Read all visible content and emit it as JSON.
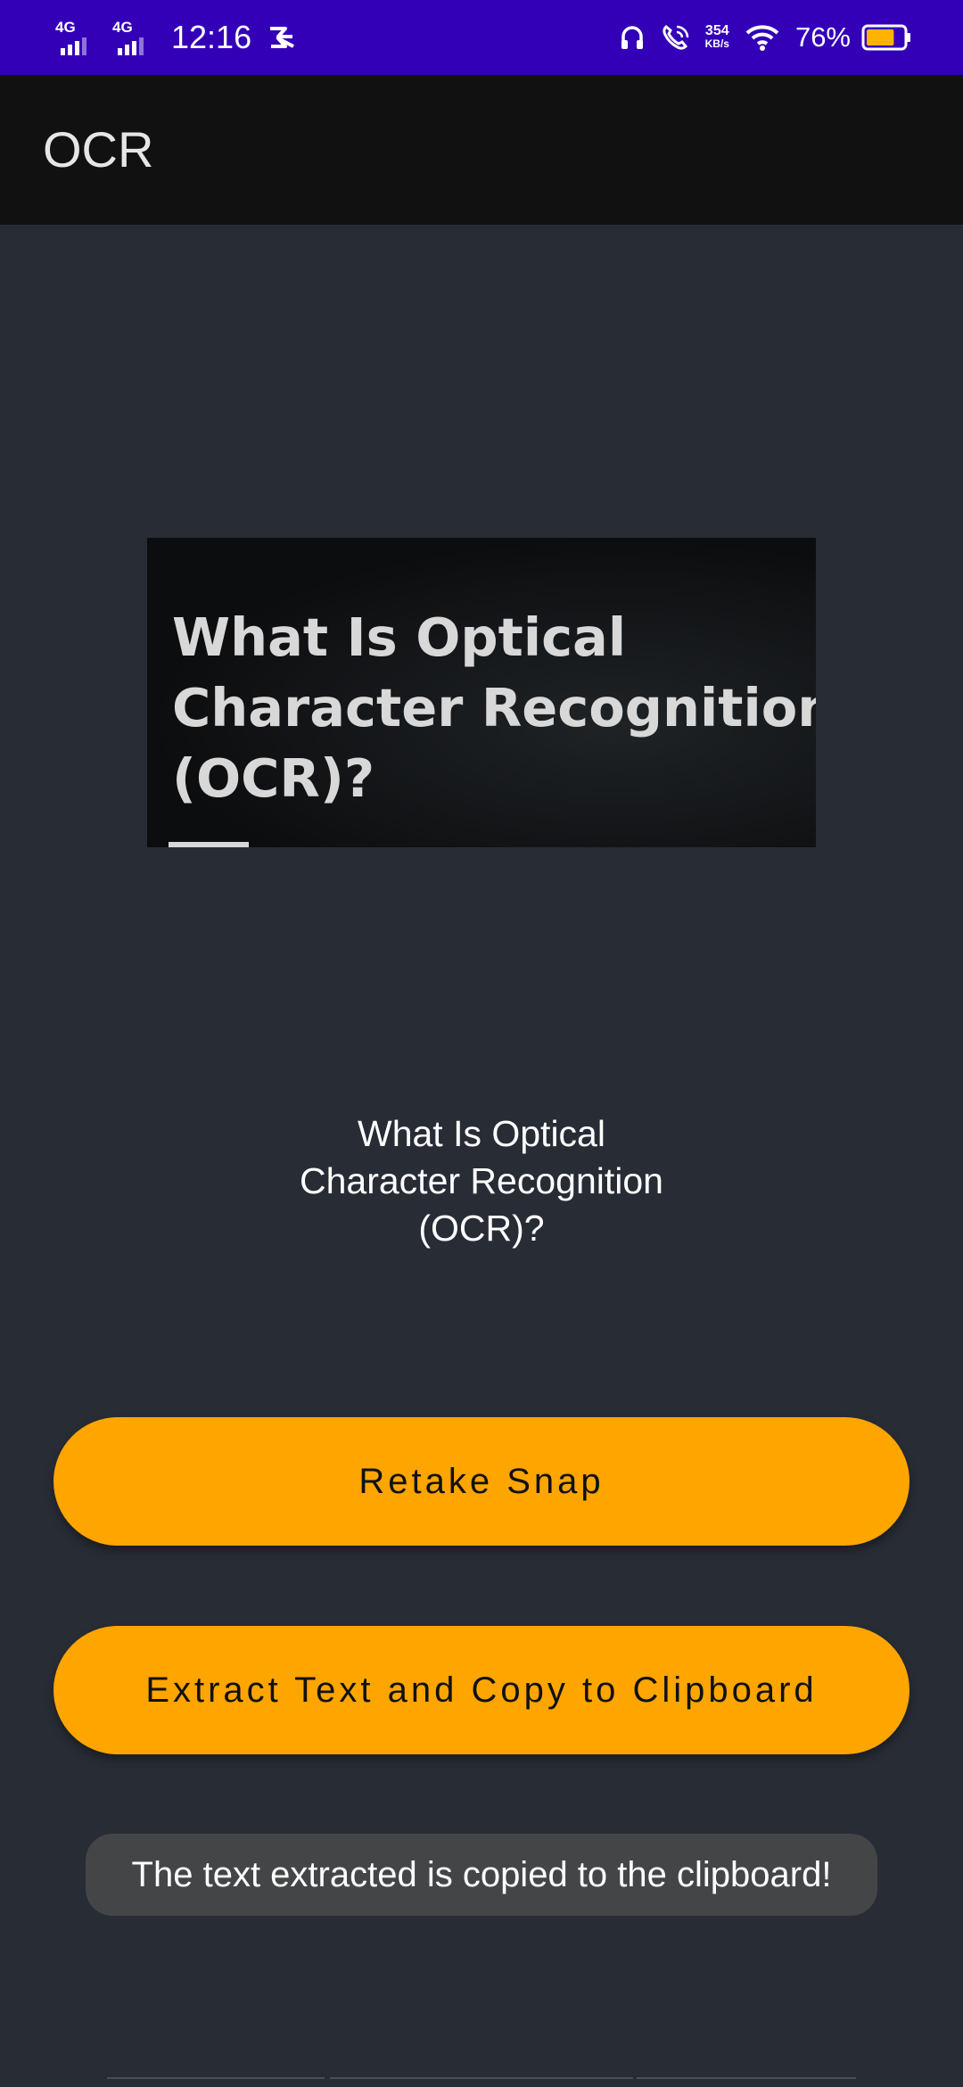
{
  "status_bar": {
    "network_1": "4G",
    "network_2": "4G",
    "time": "12:16",
    "speed_value": "354",
    "speed_unit": "KB/s",
    "battery_percent": "76%",
    "battery_level": 0.76,
    "battery_color": "#ffb300"
  },
  "app_bar": {
    "title": "OCR"
  },
  "captured_image": {
    "lines": [
      "What Is Optical",
      "Character Recognition",
      "(OCR)?"
    ]
  },
  "extracted_text": {
    "lines": [
      "What Is Optical",
      "Character Recognition",
      "(OCR)?"
    ]
  },
  "buttons": {
    "retake_label": "Retake Snap",
    "extract_label": "Extract Text and Copy to Clipboard",
    "accent_color": "#ffa500"
  },
  "toast": {
    "message": "The text extracted is copied to the clipboard!"
  }
}
